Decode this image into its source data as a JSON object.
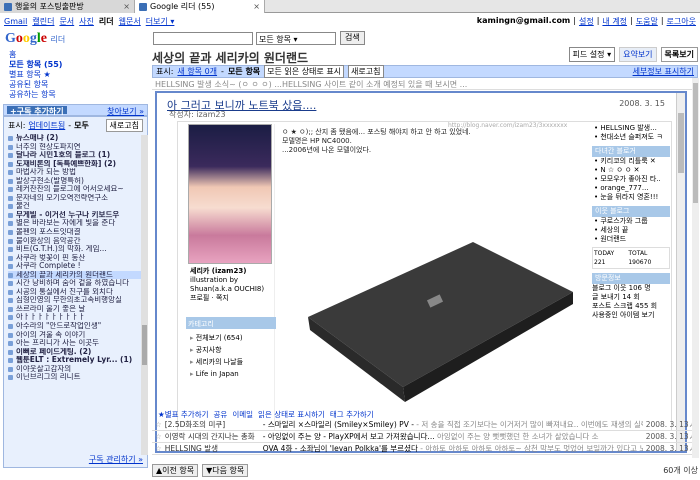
{
  "tabs": [
    {
      "label": "행울의 포스팅출판방",
      "active": false
    },
    {
      "label": "Google 리더 (55)",
      "active": true
    }
  ],
  "gbar": {
    "links": [
      "Gmail",
      "캘린더",
      "문서",
      "사진"
    ],
    "current": "리더",
    "links2": [
      "웹문서",
      "더보기 ▾"
    ],
    "email": "kamingn@gmail.com",
    "right": [
      "설정",
      "내 계정",
      "도움말",
      "로그아웃"
    ]
  },
  "logo": {
    "g": "Google",
    "product": "리더"
  },
  "search": {
    "value": "",
    "scope": "모든 항목",
    "button": "검색"
  },
  "nav": {
    "home": "홈",
    "all": "모든 항목 (55)",
    "starred": "별표 항목 ★",
    "shared": "공유된 항목",
    "friends": "공유하는 항목"
  },
  "subscribe": {
    "add": "+구독 추가하기",
    "more": "찾아보기 »"
  },
  "subs": {
    "show_label": "표시:",
    "show_link": "업데이트됨",
    "show_all": "모두",
    "refresh": "새로고침",
    "items": [
      {
        "t": "뉴스매냐 (2)",
        "b": true,
        "sel": false
      },
      {
        "t": "너추의 현상도파지연",
        "b": false,
        "sel": false
      },
      {
        "t": "달나라 시민1호의 블로그 (1)",
        "b": true,
        "sel": false
      },
      {
        "t": "도재비론의 [독특예쁘한화] (2)",
        "b": true,
        "sel": false
      },
      {
        "t": "마법사가 되는 방법",
        "b": false,
        "sel": false
      },
      {
        "t": "발상구현소(발명특허)",
        "b": false,
        "sel": false
      },
      {
        "t": "레커찬찬의 블로그에 어서오세요~",
        "b": false,
        "sel": false
      },
      {
        "t": "문자네의 모기오역전략연구소",
        "b": false,
        "sel": false
      },
      {
        "t": "물건",
        "b": false,
        "sel": false
      },
      {
        "t": "무게빌 - 이거선 누구나 키보드우",
        "b": true,
        "sel": false
      },
      {
        "t": "별은 바라보는 자에게 빛을 준다",
        "b": false,
        "sel": false
      },
      {
        "t": "볼펜의 포스트잇대결",
        "b": false,
        "sel": false
      },
      {
        "t": "불이환상의 음악공간",
        "b": false,
        "sel": false
      },
      {
        "t": "비트(G.T.H.)의 막화. 게임...",
        "b": false,
        "sel": false
      },
      {
        "t": "사쿠라 벚꽃이 핀 동산",
        "b": false,
        "sel": false
      },
      {
        "t": "사쿠라 Complete !",
        "b": false,
        "sel": false
      },
      {
        "t": "세상의 끝과 세리카의 원더랜드",
        "b": false,
        "sel": true
      },
      {
        "t": "시간 낭비하며 숨어 겉을 하였습니다",
        "b": false,
        "sel": false
      },
      {
        "t": "시공의 통실에서 친구를 외치다",
        "b": false,
        "sel": false
      },
      {
        "t": "심형민영의 무한의초고속비행앙실",
        "b": false,
        "sel": false
      },
      {
        "t": "쓰르라미 울기 좋은 날",
        "b": false,
        "sel": false
      },
      {
        "t": "아ㅏㅏㅏㅏㅏㅏㅏㅏㅏ",
        "b": false,
        "sel": false
      },
      {
        "t": "아수라의 \"안드로작업인생\"",
        "b": false,
        "sel": false
      },
      {
        "t": "아이의 겨울 속 이야기",
        "b": false,
        "sel": false
      },
      {
        "t": "아는 프리니가 사는 이곳두",
        "b": false,
        "sel": false
      },
      {
        "t": "이뻐로 페이드게팅. (2)",
        "b": true,
        "sel": false
      },
      {
        "t": "웹툰ELT : Extremely Lyr... (1)",
        "b": true,
        "sel": false
      },
      {
        "t": "이야웃살고감자의",
        "b": false,
        "sel": false
      },
      {
        "t": "이닌브리그의 리니트",
        "b": false,
        "sel": false
      }
    ],
    "manage": "구독 관리하기 »"
  },
  "main": {
    "title": "세상의 끝과 세리카의 원더랜드",
    "settings": "피드 설정 ▾",
    "view_expanded": "요약보기",
    "view_list": "목록보기",
    "bar_show": "표시:",
    "bar_new": "새 항목 0개",
    "bar_all": "모든 항목",
    "mark_read": "모든 읽은 상태로 표시",
    "refresh": "새로고침",
    "details": "세부정보 표시하기",
    "prev_entry": "HELLSING 발생 소식~ (ㅇ ㅇ ㅇ) ...HELLSING 사이트 같이 소개 예정되 있을 때 보시면 ...",
    "entry": {
      "title": "아 그러고 보니까 노트북 샀음....",
      "date": "2008. 3. 15",
      "author": "작성자: izam23",
      "url": "http://blog.naver.com/izam23/3xxxxxxx",
      "body": [
        "ㅇ ★ ㅇ);; 산지 좀 됐음에... 포스팅 해야지 하고 안 하고 있었네.",
        "모델명은 HP NC4000.",
        "...2006년에 나온 모델이었다."
      ],
      "profile_name": "세리카 (izam23)",
      "profile_desc": "illustration by Shuan(a.k.a OUCHI8)",
      "profile_links": "프로필 · 쪽지",
      "category": "카테고리",
      "cat_items": [
        "전체보기 (654)",
        "공지사항",
        "세리카의 나날들",
        "Life in Japan"
      ],
      "right_heads": [
        "다녀간 블로거",
        "이웃 블로그",
        "방문정보"
      ],
      "right_top": [
        "HELLSING 발생...",
        "천대소년 슬퍼져도 ㅋ"
      ],
      "right_visitors": [
        "키리코의 리틀룩 ✕",
        "N ☆ ㅇ ㅇ ✕",
        "모모우가 좋아진 타..",
        "orange_777...",
        "눈을 뒤라지 영혼!!!"
      ],
      "right_neighbors": [
        "쿠로스가와 그룹",
        "세상의 끝",
        "원더랜드"
      ],
      "stats": [
        "TODAY 221",
        "TOTAL 190670"
      ],
      "right_visit": [
        "블로그 이웃 106 명",
        "글 보내기 14 회",
        "포스트 스크랩 455 회",
        "사용중인 아이템 보기"
      ]
    },
    "actions": [
      "★별표 추가하기",
      "공유",
      "이메일",
      "읽은 상태로 표시하기",
      "태그 추가하기"
    ],
    "rows": [
      {
        "src": "[2.5D화조의 미쿠]",
        "title": "- 스마일리 ×스마일리 (Smiley×Smiley) PV -",
        "snip": " - 저 송을 직접 조기보다는 이거저거 많이 빠져내요.. 이번에도 재생의 실력",
        "date": "2008. 3. 13"
      },
      {
        "src": "이영락 시대의 간지나는 총화",
        "title": "- 아잉없이 주는 양 - PlayXP에서 보고 가져왔습니다...",
        "snip": " 아잉없이 주는 양 뻣뻣했던 한 소녀가 살았습니다 소",
        "date": "2008. 3. 13"
      },
      {
        "src": "HELLSING 발생",
        "title": "OVA 4화 - 소좌님이 'Ievan Polkka'를 부르셨다",
        "snip": " - 아하토 아하토 아하토 아하토~ 삼천 막부도 멋었어 보일까가 있다고 노",
        "date": "2008. 3. 13"
      }
    ],
    "prev_btn": "▲이전 항목",
    "next_btn": "▼다음 항목",
    "count": "60개 이상"
  }
}
